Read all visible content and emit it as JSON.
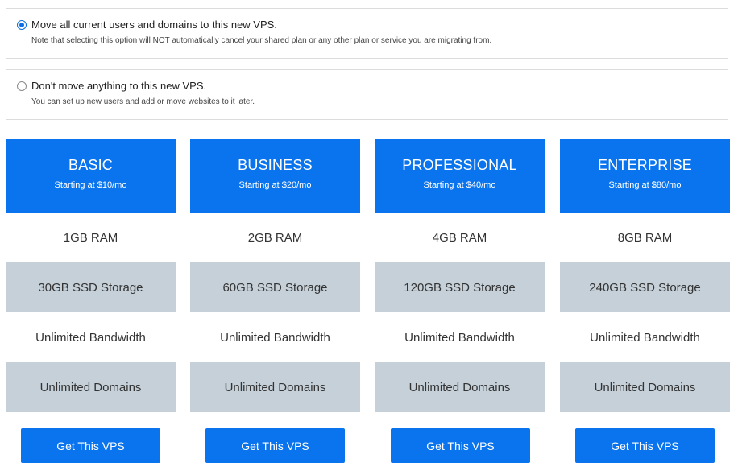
{
  "options": [
    {
      "title": "Move all current users and domains to this new VPS.",
      "note": "Note that selecting this option will NOT automatically cancel your shared plan or any other plan or service you are migrating from.",
      "selected": true
    },
    {
      "title": "Don't move anything to this new VPS.",
      "note": "You can set up new users and add or move websites to it later.",
      "selected": false
    }
  ],
  "plans": [
    {
      "name": "BASIC",
      "price": "Starting at $10/mo",
      "ram": "1GB RAM",
      "storage": "30GB SSD Storage",
      "bandwidth": "Unlimited Bandwidth",
      "domains": "Unlimited Domains",
      "button": "Get This VPS"
    },
    {
      "name": "BUSINESS",
      "price": "Starting at $20/mo",
      "ram": "2GB RAM",
      "storage": "60GB SSD Storage",
      "bandwidth": "Unlimited Bandwidth",
      "domains": "Unlimited Domains",
      "button": "Get This VPS"
    },
    {
      "name": "PROFESSIONAL",
      "price": "Starting at $40/mo",
      "ram": "4GB RAM",
      "storage": "120GB SSD Storage",
      "bandwidth": "Unlimited Bandwidth",
      "domains": "Unlimited Domains",
      "button": "Get This VPS"
    },
    {
      "name": "ENTERPRISE",
      "price": "Starting at $80/mo",
      "ram": "8GB RAM",
      "storage": "240GB SSD Storage",
      "bandwidth": "Unlimited Bandwidth",
      "domains": "Unlimited Domains",
      "button": "Get This VPS"
    }
  ],
  "colors": {
    "accent": "#0a74ee",
    "feature_shade": "#c5d0d9"
  }
}
